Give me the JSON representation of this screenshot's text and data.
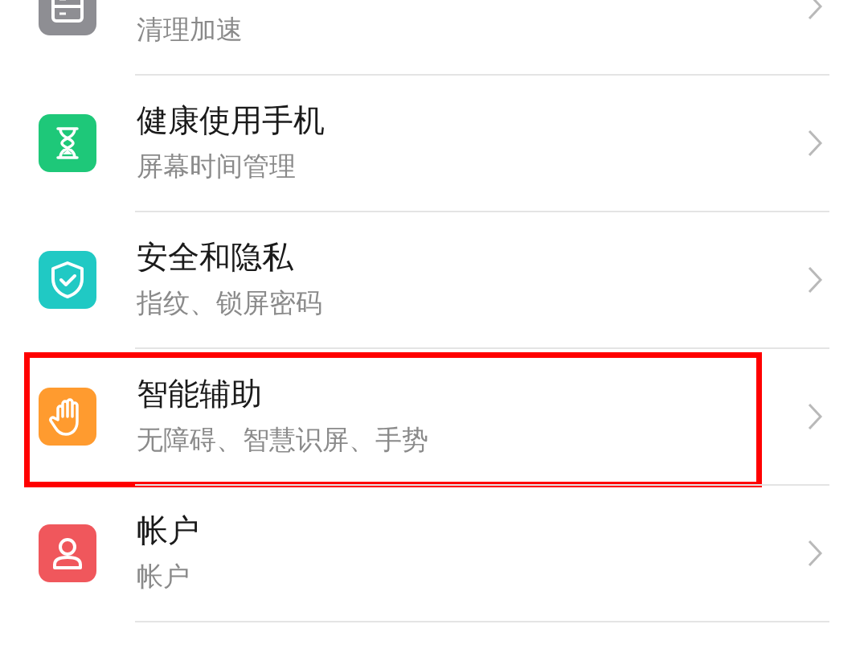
{
  "settings": [
    {
      "subtitle": "清理加速",
      "color": "#8e8e93",
      "highlighted": false
    },
    {
      "title": "健康使用手机",
      "subtitle": "屏幕时间管理",
      "color": "#1ec879",
      "highlighted": false
    },
    {
      "title": "安全和隐私",
      "subtitle": "指纹、锁屏密码",
      "color": "#20c9c4",
      "highlighted": false
    },
    {
      "title": "智能辅助",
      "subtitle": "无障碍、智慧识屏、手势",
      "color": "#ff9b2f",
      "highlighted": true
    },
    {
      "title": "帐户",
      "subtitle": "帐户",
      "color": "#f0575c",
      "highlighted": false
    }
  ]
}
